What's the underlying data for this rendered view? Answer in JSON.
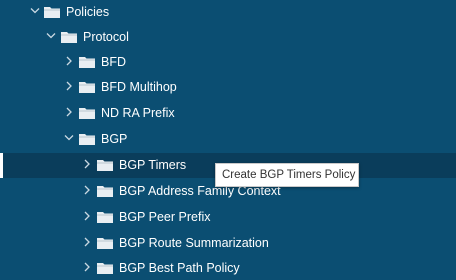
{
  "tree": {
    "nodes": [
      {
        "label": "Policies",
        "state": "expanded"
      },
      {
        "label": "Protocol",
        "state": "expanded"
      },
      {
        "label": "BFD",
        "state": "collapsed"
      },
      {
        "label": "BFD Multihop",
        "state": "collapsed"
      },
      {
        "label": "ND RA Prefix",
        "state": "collapsed"
      },
      {
        "label": "BGP",
        "state": "expanded"
      },
      {
        "label": "BGP Timers",
        "state": "collapsed",
        "selected": true
      },
      {
        "label": "BGP Address Family Context",
        "state": "collapsed"
      },
      {
        "label": "BGP Peer Prefix",
        "state": "collapsed"
      },
      {
        "label": "BGP Route Summarization",
        "state": "collapsed"
      },
      {
        "label": "BGP Best Path Policy",
        "state": "collapsed"
      }
    ]
  },
  "tooltip": {
    "text": "Create BGP Timers Policy"
  },
  "icons": {
    "expanded": "chevron-down-icon",
    "collapsed": "chevron-right-icon",
    "node": "folder-icon"
  },
  "colors": {
    "background": "#0b4e72",
    "selected_row": "#0a3d5b",
    "text": "#ffffff",
    "folder": "#e9eef2"
  }
}
